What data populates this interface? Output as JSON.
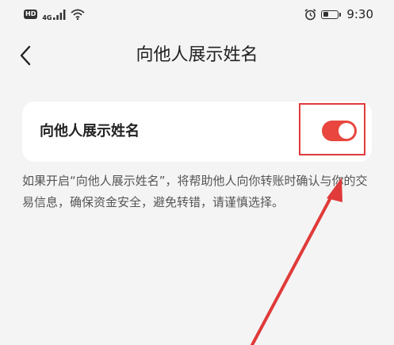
{
  "status_bar": {
    "hd_badge": "HD",
    "network": "4G",
    "battery_level": 0.35,
    "time": "9:30"
  },
  "nav": {
    "title": "向他人展示姓名"
  },
  "setting": {
    "label": "向他人展示姓名",
    "enabled": true
  },
  "description": "如果开启“向他人展示姓名”，将帮助他人向你转账时确认与你的交易信息，确保资金安全，避免转错，请谨慎选择。",
  "colors": {
    "accent": "#e8463e",
    "annotation": "#e03a3a",
    "background": "#f4f4f4"
  }
}
